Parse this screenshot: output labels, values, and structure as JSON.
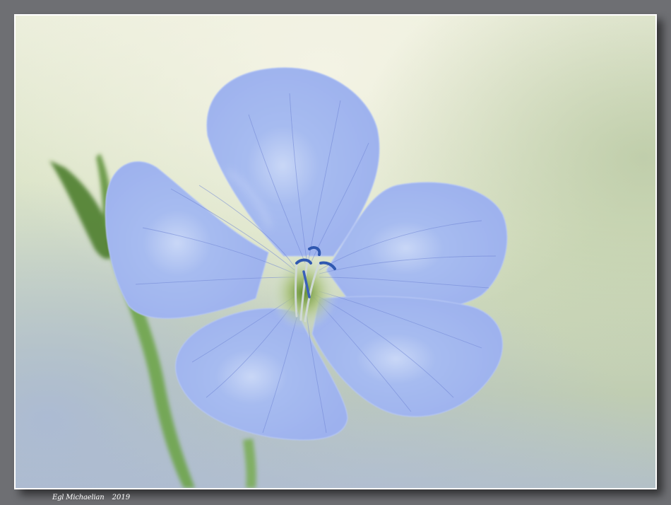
{
  "photo": {
    "subject": "blue flax flower",
    "colors": {
      "background_mat": "#6e6f73",
      "frame_border": "#ffffff",
      "bg_light": "#eeeedd",
      "bg_green": "#bcccaa",
      "bg_blue": "#aebbd6",
      "petal": "#9ab0ee",
      "petal_light": "#c4d2f8",
      "vein": "#6a80d2",
      "stamen": "#3e60b0",
      "center_green": "#6f9a3a",
      "stem": "#5f9a38"
    }
  },
  "signature": {
    "name": "Egl Michaelian",
    "year": "2019"
  }
}
